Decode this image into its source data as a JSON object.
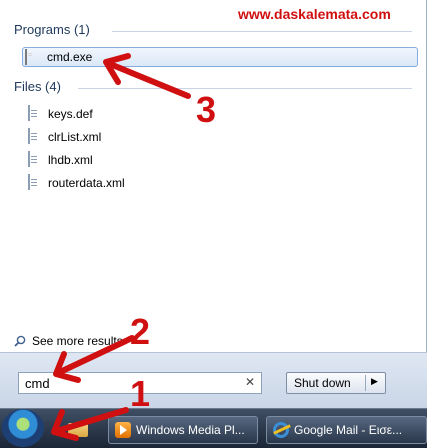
{
  "watermark": "www.daskalemata.com",
  "programs": {
    "header": "Programs (1)",
    "items": [
      {
        "label": "cmd.exe",
        "icon": "cmd-icon"
      }
    ]
  },
  "files": {
    "header": "Files (4)",
    "items": [
      {
        "label": "keys.def",
        "icon": "file-icon"
      },
      {
        "label": "clrList.xml",
        "icon": "file-icon"
      },
      {
        "label": "lhdb.xml",
        "icon": "file-icon"
      },
      {
        "label": "routerdata.xml",
        "icon": "file-icon"
      }
    ]
  },
  "see_more": "See more results",
  "search": {
    "value": "cmd",
    "clear": "✕"
  },
  "shutdown": {
    "label": "Shut down",
    "arrow": "▶"
  },
  "taskbar": {
    "buttons": [
      {
        "label": "Windows Media Pl...",
        "icon": "windows-media-player-icon"
      },
      {
        "label": "Google Mail - Εισε...",
        "icon": "internet-explorer-icon"
      }
    ]
  },
  "annotations": {
    "step1": "1",
    "step2": "2",
    "step3": "3",
    "color": "#d01010"
  }
}
